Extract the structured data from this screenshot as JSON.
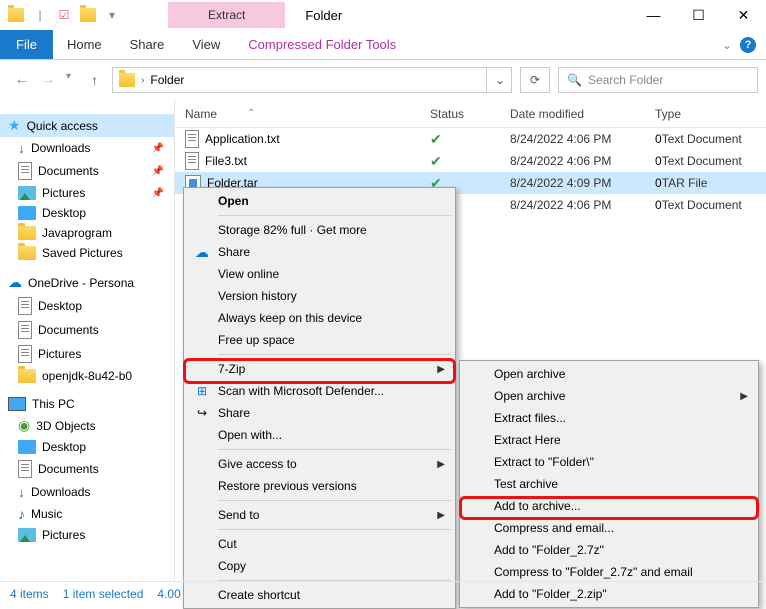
{
  "titlebar": {
    "extract_label": "Extract",
    "window_title": "Folder"
  },
  "ribbon": {
    "file": "File",
    "home": "Home",
    "share": "Share",
    "view": "View",
    "ctx_tools": "Compressed Folder Tools"
  },
  "address": {
    "path": "Folder",
    "search_placeholder": "Search Folder"
  },
  "nav": {
    "quick_access": "Quick access",
    "downloads": "Downloads",
    "documents": "Documents",
    "pictures": "Pictures",
    "desktop": "Desktop",
    "javaprogram": "Javaprogram",
    "saved_pictures": "Saved Pictures",
    "onedrive": "OneDrive - Persona",
    "od_desktop": "Desktop",
    "od_documents": "Documents",
    "od_pictures": "Pictures",
    "openjdk": "openjdk-8u42-b0",
    "this_pc": "This PC",
    "pc_3d": "3D Objects",
    "pc_desktop": "Desktop",
    "pc_documents": "Documents",
    "pc_downloads": "Downloads",
    "pc_music": "Music",
    "pc_pictures": "Pictures"
  },
  "columns": {
    "name": "Name",
    "status": "Status",
    "date": "Date modified",
    "type": "Type"
  },
  "files": [
    {
      "name": "Application.txt",
      "date": "8/24/2022 4:06 PM",
      "type": "Text Document",
      "kind": "txt"
    },
    {
      "name": "File3.txt",
      "date": "8/24/2022 4:06 PM",
      "type": "Text Document",
      "kind": "txt"
    },
    {
      "name": "Folder.tar",
      "date": "8/24/2022 4:09 PM",
      "type": "TAR File",
      "kind": "tar",
      "selected": true
    },
    {
      "name": "",
      "date": "8/24/2022 4:06 PM",
      "type": "Text Document",
      "kind": "txt"
    }
  ],
  "ctx1": {
    "open": "Open",
    "storage": "Storage 82% full · Get more",
    "share": "Share",
    "view_online": "View online",
    "version_history": "Version history",
    "always_keep": "Always keep on this device",
    "free_up": "Free up space",
    "seven_zip": "7-Zip",
    "defender": "Scan with Microsoft Defender...",
    "share2": "Share",
    "open_with": "Open with...",
    "give_access": "Give access to",
    "restore": "Restore previous versions",
    "send_to": "Send to",
    "cut": "Cut",
    "copy": "Copy",
    "create_shortcut": "Create shortcut"
  },
  "ctx2": {
    "open_archive": "Open archive",
    "open_archive2": "Open archive",
    "extract_files": "Extract files...",
    "extract_here": "Extract Here",
    "extract_to": "Extract to \"Folder\\\"",
    "test": "Test archive",
    "add_to_archive": "Add to archive...",
    "compress_email": "Compress and email...",
    "add_7z": "Add to \"Folder_2.7z\"",
    "compress_7z_email": "Compress to \"Folder_2.7z\" and email",
    "add_zip": "Add to \"Folder_2.zip\""
  },
  "status": {
    "items": "4 items",
    "selected": "1 item selected",
    "size": "4.00"
  }
}
